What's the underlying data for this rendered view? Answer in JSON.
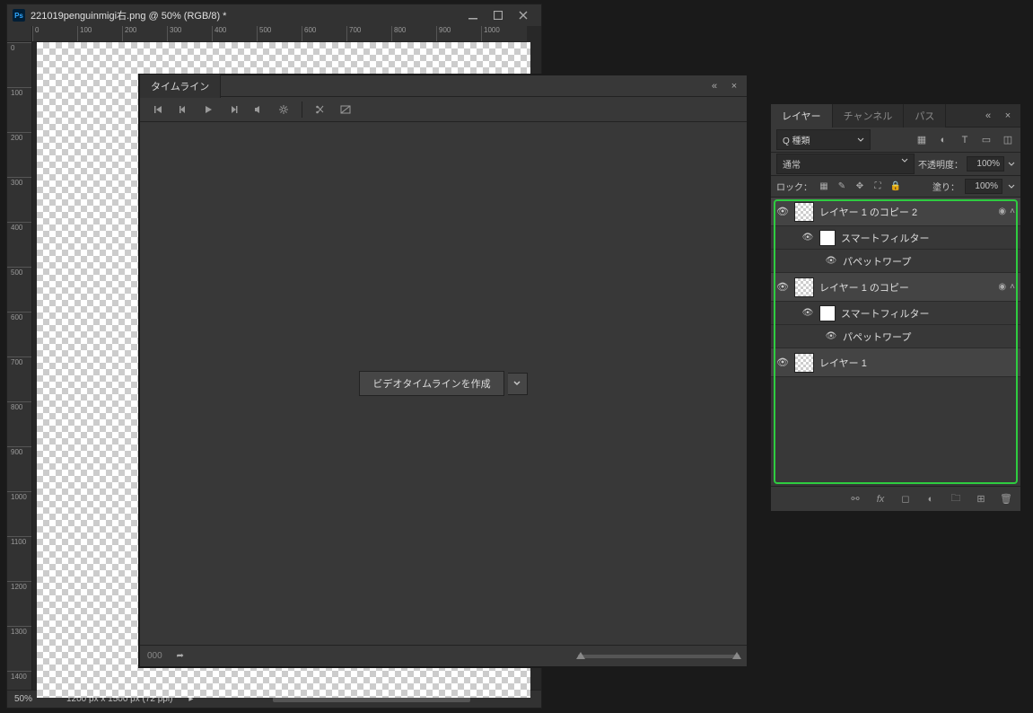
{
  "document": {
    "title": "221019penguinmigi右.png @ 50% (RGB/8) *",
    "zoom": "50%",
    "dimensions": "1200 px x 1500 px (72 ppi)",
    "ruler_top": [
      "0",
      "100",
      "200",
      "300",
      "400",
      "500",
      "600",
      "700",
      "800",
      "900",
      "1000"
    ],
    "ruler_left": [
      "0",
      "100",
      "200",
      "300",
      "400",
      "500",
      "600",
      "700",
      "800",
      "900",
      "1000",
      "1100",
      "1200",
      "1300",
      "1400"
    ]
  },
  "timeline": {
    "tab": "タイムライン",
    "create_button": "ビデオタイムラインを作成",
    "footer_label": "000"
  },
  "layers": {
    "tabs": {
      "layers": "レイヤー",
      "channels": "チャンネル",
      "paths": "パス"
    },
    "filter_prefix": "Q 種類",
    "blend_mode": "通常",
    "opacity_label": "不透明度：",
    "opacity_value": "100%",
    "lock_label": "ロック：",
    "fill_label": "塗り：",
    "fill_value": "100%",
    "items": [
      {
        "name": "レイヤー 1 のコピー 2",
        "smart": "スマートフィルター",
        "warp": "パペットワープ"
      },
      {
        "name": "レイヤー 1 のコピー",
        "smart": "スマートフィルター",
        "warp": "パペットワープ"
      },
      {
        "name": "レイヤー 1"
      }
    ]
  }
}
